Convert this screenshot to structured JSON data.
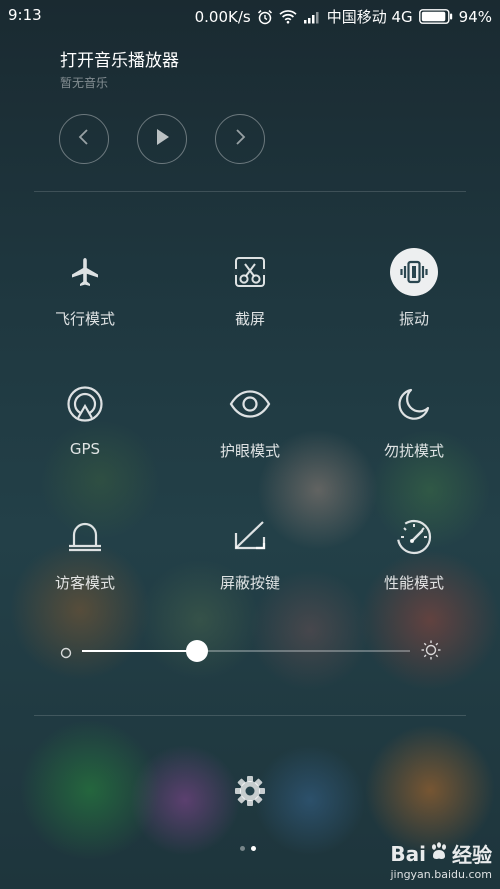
{
  "status_bar": {
    "time": "9:13",
    "net_speed": "0.00K/s",
    "carrier": "中国移动 4G",
    "battery": "94%",
    "battery_level": 0.94
  },
  "music": {
    "title": "打开音乐播放器",
    "subtitle": "暂无音乐"
  },
  "toggles": [
    {
      "label": "飞行模式",
      "icon": "airplane-icon",
      "active": false
    },
    {
      "label": "截屏",
      "icon": "screenshot-icon",
      "active": false
    },
    {
      "label": "振动",
      "icon": "vibrate-icon",
      "active": true
    },
    {
      "label": "GPS",
      "icon": "gps-icon",
      "active": false
    },
    {
      "label": "护眼模式",
      "icon": "eye-icon",
      "active": false
    },
    {
      "label": "勿扰模式",
      "icon": "moon-icon",
      "active": false
    },
    {
      "label": "访客模式",
      "icon": "guest-icon",
      "active": false
    },
    {
      "label": "屏蔽按键",
      "icon": "block-keys-icon",
      "active": false
    },
    {
      "label": "性能模式",
      "icon": "performance-icon",
      "active": false
    }
  ],
  "brightness": {
    "level": 0.35
  },
  "pager": {
    "count": 2,
    "active": 1
  },
  "watermark": {
    "brand_left": "Bai",
    "brand_right": "经验",
    "url": "jingyan.baidu.com"
  },
  "colors": {
    "accent": "#ffffff",
    "active_icon": "#2a4650"
  }
}
